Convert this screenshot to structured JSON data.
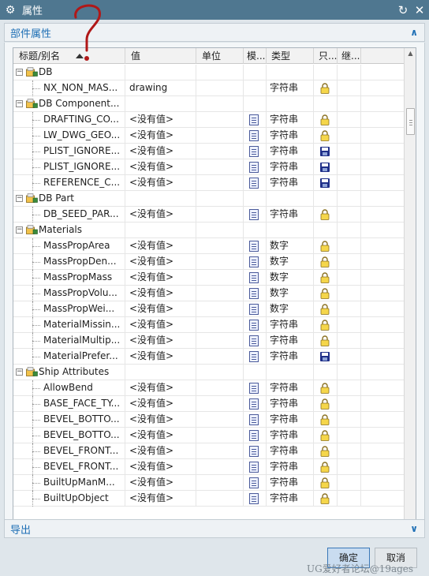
{
  "window": {
    "title": "属性",
    "gear_icon": "gear-icon",
    "reset_icon": "reset-icon",
    "close_icon": "close-icon",
    "titlebar_color": "#4f7790"
  },
  "sections": {
    "parts_label": "部件属性",
    "export_label": "导出",
    "collapse_icon": "chevron-up-icon",
    "expand_icon": "chevron-down-icon",
    "accent": "#1e6fb5"
  },
  "table": {
    "headers": [
      "标题/别名",
      "值",
      "单位",
      "模...",
      "类型",
      "只...",
      "继..."
    ],
    "sorted_column": "标题/别名",
    "rows": [
      {
        "kind": "group",
        "name": "DB"
      },
      {
        "kind": "leaf",
        "name": "NX_NON_MAS...",
        "value": "drawing",
        "type": "字符串",
        "mod": "",
        "ro": "lock"
      },
      {
        "kind": "group",
        "name": "DB Component..."
      },
      {
        "kind": "leaf",
        "name": "DRAFTING_CO...",
        "value": "<没有值>",
        "type": "字符串",
        "mod": "doc",
        "ro": "lock"
      },
      {
        "kind": "leaf",
        "name": "LW_DWG_GEO...",
        "value": "<没有值>",
        "type": "字符串",
        "mod": "doc",
        "ro": "lock"
      },
      {
        "kind": "leaf",
        "name": "PLIST_IGNORE...",
        "value": "<没有值>",
        "type": "字符串",
        "mod": "doc",
        "ro": "disk"
      },
      {
        "kind": "leaf",
        "name": "PLIST_IGNORE...",
        "value": "<没有值>",
        "type": "字符串",
        "mod": "doc",
        "ro": "disk"
      },
      {
        "kind": "leaf",
        "name": "REFERENCE_C...",
        "value": "<没有值>",
        "type": "字符串",
        "mod": "doc",
        "ro": "disk"
      },
      {
        "kind": "group",
        "name": "DB Part"
      },
      {
        "kind": "leaf",
        "name": "DB_SEED_PAR...",
        "value": "<没有值>",
        "type": "字符串",
        "mod": "doc",
        "ro": "lock"
      },
      {
        "kind": "group",
        "name": "Materials"
      },
      {
        "kind": "leaf",
        "name": "MassPropArea",
        "value": "<没有值>",
        "type": "数字",
        "mod": "doc",
        "ro": "lock"
      },
      {
        "kind": "leaf",
        "name": "MassPropDen...",
        "value": "<没有值>",
        "type": "数字",
        "mod": "doc",
        "ro": "lock"
      },
      {
        "kind": "leaf",
        "name": "MassPropMass",
        "value": "<没有值>",
        "type": "数字",
        "mod": "doc",
        "ro": "lock"
      },
      {
        "kind": "leaf",
        "name": "MassPropVolu...",
        "value": "<没有值>",
        "type": "数字",
        "mod": "doc",
        "ro": "lock"
      },
      {
        "kind": "leaf",
        "name": "MassPropWei...",
        "value": "<没有值>",
        "type": "数字",
        "mod": "doc",
        "ro": "lock"
      },
      {
        "kind": "leaf",
        "name": "MaterialMissin...",
        "value": "<没有值>",
        "type": "字符串",
        "mod": "doc",
        "ro": "lock"
      },
      {
        "kind": "leaf",
        "name": "MaterialMultip...",
        "value": "<没有值>",
        "type": "字符串",
        "mod": "doc",
        "ro": "lock"
      },
      {
        "kind": "leaf",
        "name": "MaterialPrefer...",
        "value": "<没有值>",
        "type": "字符串",
        "mod": "doc",
        "ro": "disk"
      },
      {
        "kind": "group",
        "name": "Ship Attributes"
      },
      {
        "kind": "leaf",
        "name": "AllowBend",
        "value": "<没有值>",
        "type": "字符串",
        "mod": "doc",
        "ro": "lock"
      },
      {
        "kind": "leaf",
        "name": "BASE_FACE_TY...",
        "value": "<没有值>",
        "type": "字符串",
        "mod": "doc",
        "ro": "lock"
      },
      {
        "kind": "leaf",
        "name": "BEVEL_BOTTO...",
        "value": "<没有值>",
        "type": "字符串",
        "mod": "doc",
        "ro": "lock"
      },
      {
        "kind": "leaf",
        "name": "BEVEL_BOTTO...",
        "value": "<没有值>",
        "type": "字符串",
        "mod": "doc",
        "ro": "lock"
      },
      {
        "kind": "leaf",
        "name": "BEVEL_FRONT...",
        "value": "<没有值>",
        "type": "字符串",
        "mod": "doc",
        "ro": "lock"
      },
      {
        "kind": "leaf",
        "name": "BEVEL_FRONT...",
        "value": "<没有值>",
        "type": "字符串",
        "mod": "doc",
        "ro": "lock"
      },
      {
        "kind": "leaf",
        "name": "BuiltUpManM...",
        "value": "<没有值>",
        "type": "字符串",
        "mod": "doc",
        "ro": "lock"
      },
      {
        "kind": "leaf",
        "name": "BuiltUpObject",
        "value": "<没有值>",
        "type": "字符串",
        "mod": "doc",
        "ro": "lock"
      }
    ]
  },
  "buttons": {
    "ok": "确定",
    "cancel": "取消"
  },
  "watermark": "UG爱好者论坛@19ages"
}
